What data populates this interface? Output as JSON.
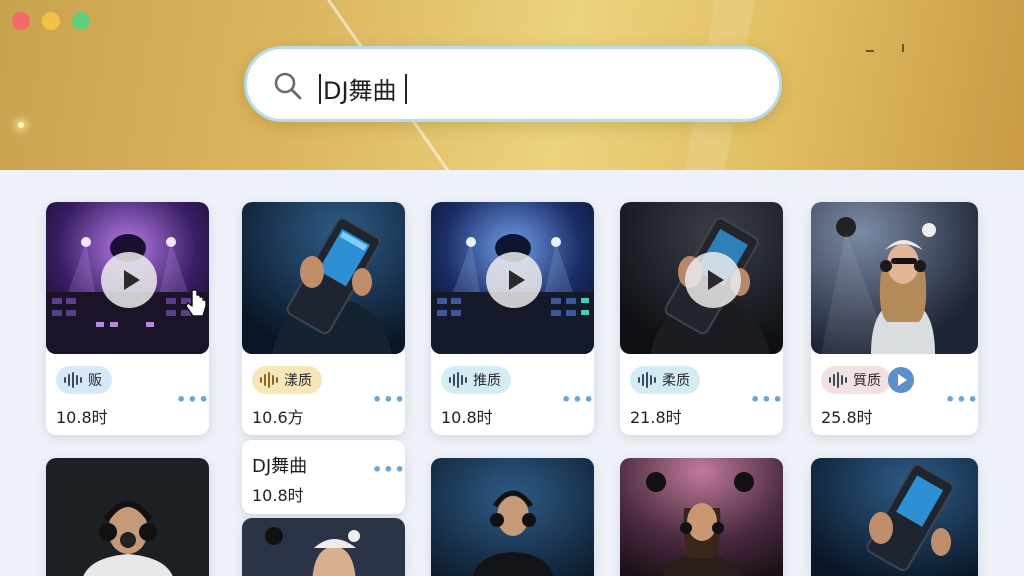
{
  "window": {
    "controls": [
      "close",
      "minimize",
      "maximize"
    ]
  },
  "search": {
    "query": "DJ舞曲",
    "icon": "search-icon"
  },
  "cards": [
    {
      "tag": "贩",
      "duration": "10.8时",
      "more": "•••"
    },
    {
      "tag": "漾质",
      "duration": "10.6方",
      "more": "•••"
    },
    {
      "tag": "推质",
      "duration": "10.8时",
      "more": "•••"
    },
    {
      "tag": "柔质",
      "duration": "21.8时",
      "more": "•••"
    },
    {
      "tag": "質质",
      "duration": "25.8时",
      "more": "•••"
    }
  ],
  "extra_card": {
    "title": "DJ舞曲",
    "duration": "10.8时",
    "more": "•••"
  },
  "colors": {
    "header_gold": "#dcb75f",
    "search_border": "#b8dcef",
    "chip_blue": "#d6e9f7",
    "chip_yellow": "#f7e6b8",
    "chip_teal": "#d3ecf3",
    "chip_pink": "#f1e1e1",
    "accent_blue": "#5d8fc8"
  }
}
